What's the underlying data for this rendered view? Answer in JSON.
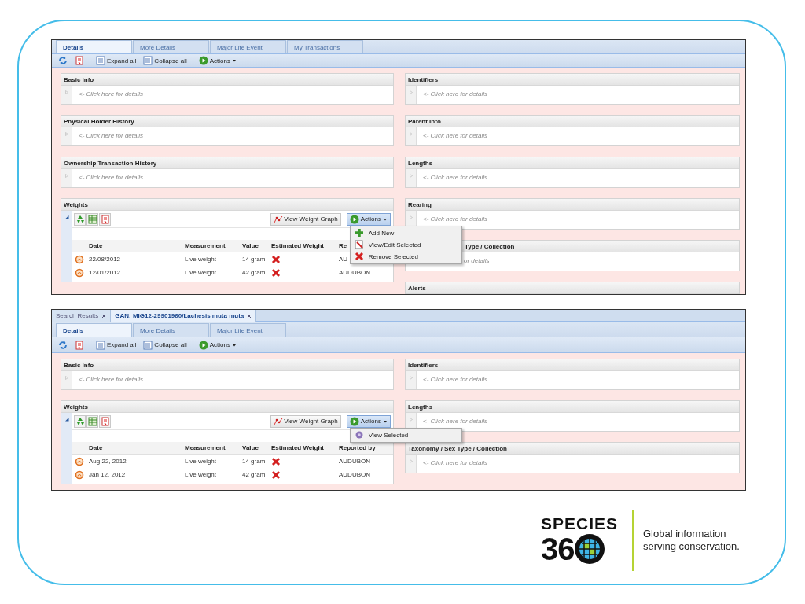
{
  "screens": [
    {
      "tabs": [
        {
          "label": "Details",
          "selected": true
        },
        {
          "label": "More Details",
          "selected": false
        },
        {
          "label": "Major Life Event",
          "selected": false
        },
        {
          "label": "My Transactions",
          "selected": false
        }
      ],
      "toolbar": {
        "expand": "Expand all",
        "collapse": "Collapse all",
        "actions": "Actions"
      },
      "left_panels": [
        {
          "kind": "collapsed",
          "title": "Basic Info",
          "hint": "<- Click here for details"
        },
        {
          "kind": "collapsed",
          "title": "Physical Holder History",
          "hint": "<- Click here for details"
        },
        {
          "kind": "collapsed",
          "title": "Ownership Transaction History",
          "hint": "<- Click here for details"
        },
        {
          "kind": "weights",
          "title": "Weights",
          "graph_button": "View Weight Graph",
          "actions": "Actions",
          "columns": [
            "Date",
            "Measurement",
            "Value",
            "Estimated Weight",
            "Re"
          ],
          "rows": [
            {
              "date": "22/08/2012",
              "measurement": "Live weight",
              "value": "14 gram",
              "estimated": false,
              "reported_by": "AU"
            },
            {
              "date": "12/01/2012",
              "measurement": "Live weight",
              "value": "42 gram",
              "estimated": false,
              "reported_by": "AUDUBON"
            }
          ],
          "menu": [
            {
              "kind": "add",
              "label": "Add New"
            },
            {
              "kind": "edit",
              "label": "View/Edit Selected"
            },
            {
              "kind": "remove",
              "label": "Remove Selected"
            }
          ]
        }
      ],
      "right_panels": [
        {
          "kind": "collapsed",
          "title": "Identifiers",
          "hint": "<- Click here for details"
        },
        {
          "kind": "collapsed",
          "title": "Parent Info",
          "hint": "<- Click here for details"
        },
        {
          "kind": "collapsed",
          "title": "Lengths",
          "hint": "<- Click here for details"
        },
        {
          "kind": "collapsed",
          "title": "Rearing",
          "hint": "<- Click here for details"
        },
        {
          "kind": "covered",
          "title": "Type / Collection",
          "hint": "or details"
        },
        {
          "kind": "collapsed",
          "title": "Alerts"
        }
      ]
    },
    {
      "doc_tabs": [
        {
          "label": "Search Results",
          "selected": false
        },
        {
          "label": "GAN: MIG12-29901960/Lachesis muta muta",
          "selected": true
        }
      ],
      "tabs": [
        {
          "label": "Details",
          "selected": true
        },
        {
          "label": "More Details",
          "selected": false
        },
        {
          "label": "Major Life Event",
          "selected": false
        }
      ],
      "toolbar": {
        "expand": "Expand all",
        "collapse": "Collapse all",
        "actions": "Actions"
      },
      "left_panels": [
        {
          "kind": "collapsed",
          "title": "Basic Info",
          "hint": "<- Click here for details"
        },
        {
          "kind": "weights",
          "title": "Weights",
          "graph_button": "View Weight Graph",
          "actions": "Actions",
          "columns": [
            "Date",
            "Measurement",
            "Value",
            "Estimated Weight",
            "Reported by"
          ],
          "rows": [
            {
              "date": "Aug 22, 2012",
              "measurement": "Live weight",
              "value": "14 gram",
              "estimated": false,
              "reported_by": "AUDUBON"
            },
            {
              "date": "Jan 12, 2012",
              "measurement": "Live weight",
              "value": "42 gram",
              "estimated": false,
              "reported_by": "AUDUBON"
            }
          ],
          "menu": [
            {
              "kind": "view",
              "label": "View Selected"
            }
          ]
        }
      ],
      "right_panels": [
        {
          "kind": "collapsed",
          "title": "Identifiers",
          "hint": "<- Click here for details"
        },
        {
          "kind": "collapsed",
          "title": "Lengths",
          "hint": "<- Click here for details"
        },
        {
          "kind": "collapsed",
          "title": "Taxonomy / Sex Type / Collection",
          "hint": "<- Click here for details"
        }
      ]
    }
  ],
  "logo": {
    "word": "SPECIES",
    "number": "36",
    "tagline": "Global information serving conservation."
  }
}
